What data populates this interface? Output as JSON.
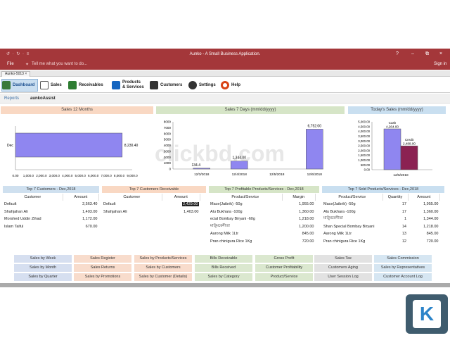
{
  "window": {
    "title": "Aunko - A Small Business Application.",
    "file_label": "File",
    "tell_me": "Tell me what you want to do...",
    "signin": "Sign in",
    "qat": "↺ · ↻ · ≡",
    "controls": [
      "?",
      "–",
      "⧉",
      "×"
    ]
  },
  "doc_tab": "Aunko-5013",
  "ribbon": {
    "items": [
      {
        "label": "Dashboard",
        "icon": "dashboard-icon",
        "color": "#3a7a3a"
      },
      {
        "label": "Sales",
        "icon": "bag-icon",
        "color": "#555"
      },
      {
        "label": "Receivables",
        "icon": "money-icon",
        "color": "#2e7d32"
      },
      {
        "label": "Products",
        "label2": "& Services",
        "icon": "box-icon",
        "color": "#1565c0"
      },
      {
        "label": "Customers",
        "icon": "people-icon",
        "color": "#333"
      },
      {
        "label": "Settings",
        "icon": "gear-icon",
        "color": "#333"
      },
      {
        "label": "Help",
        "icon": "lifebuoy-icon",
        "color": "#d84315"
      }
    ]
  },
  "reports_bar": {
    "reports": "Reports",
    "user": "aunkoAssist"
  },
  "panels": {
    "sales12": "Sales 12 Months",
    "sales7": "Sales 7 Days (mm/dd/yyyy)",
    "today": "Today's Sales (mm/dd/yyyy)"
  },
  "chart_data": [
    {
      "type": "bar",
      "orientation": "horizontal",
      "categories": [
        "Dec"
      ],
      "values": [
        8230.4
      ],
      "value_labels": [
        "8,230.40"
      ],
      "xticks": [
        "0.00",
        "1,000.0",
        "2,000.0",
        "3,000.0",
        "4,000.0",
        "5,000.0",
        "6,000.0",
        "7,000.0",
        "8,000.0",
        "9,000.0"
      ],
      "xlim": [
        0,
        9000
      ]
    },
    {
      "type": "bar",
      "categories": [
        "12/3/2018",
        "12/4/2018",
        "12/5/2018",
        "12/6/2018"
      ],
      "values": [
        134.4,
        1344.0,
        0,
        6752.0
      ],
      "value_labels": [
        "134.4",
        "1,344.00",
        "",
        "6,752.00"
      ],
      "yticks": [
        "0",
        "1000",
        "2000",
        "3000",
        "4000",
        "5000",
        "6000",
        "7000",
        "8000"
      ],
      "ylim": [
        0,
        8000
      ]
    },
    {
      "type": "bar",
      "categories": [
        "12/6/2018"
      ],
      "series": [
        {
          "name": "Cash",
          "values": [
            4264.0
          ],
          "color": "#8f86f0"
        },
        {
          "name": "Credit",
          "values": [
            2488.0
          ],
          "color": "#8b2252"
        }
      ],
      "value_labels": [
        "4,264.00",
        "2,488.00"
      ],
      "yticks": [
        "0.00",
        "500.00",
        "1,000.00",
        "1,500.00",
        "2,000.00",
        "2,500.00",
        "3,000.00",
        "3,500.00",
        "4,000.00",
        "4,500.00",
        "5,000.00"
      ],
      "ylim": [
        0,
        5000
      ]
    }
  ],
  "grids": {
    "customers": {
      "title": "Top 7 Customers - Dec,2018",
      "cols": [
        "Customer",
        "Amount"
      ],
      "rows": [
        [
          "Default",
          "2,563.40"
        ],
        [
          "Shahjahan Ali",
          "1,403.00"
        ],
        [
          "Morshed Uddin Zihad",
          "1,172.00"
        ],
        [
          "Islam Taiful",
          "670.00"
        ]
      ]
    },
    "receivable": {
      "title": "Top 7 Customers Receivable",
      "cols": [
        "Customer",
        "Amount"
      ],
      "rows": [
        [
          "Default",
          "2,429.00"
        ],
        [
          "Shahjahan Ali",
          "1,403.00"
        ]
      ]
    },
    "profitable": {
      "title": "Top 7 Profitable Products/Services - Dec,2018",
      "cols": [
        "Product/Service",
        "Margin"
      ],
      "rows": [
        [
          "Mace(Jaibrik) -50g",
          "1,955.00"
        ],
        [
          "Alu Bukhara -100g",
          "1,360.00"
        ],
        [
          "ecial Bombay Biryani -60g",
          "1,218.00"
        ],
        [
          "মাউুমরেনীতা",
          "1,200.00"
        ],
        [
          "Aarong Milk 1Ltr",
          "845.00"
        ],
        [
          "Pran chinigura Rice 1Kg",
          "720.00"
        ]
      ]
    },
    "sold": {
      "title": "Top 7 Sold Products/Services - Dec,2018",
      "cols": [
        "Product/Service",
        "Quantity",
        "Amount"
      ],
      "rows": [
        [
          "Mace(Jaibrik) -50g",
          "17",
          "1,955.00"
        ],
        [
          "Alu Bukhara -100g",
          "17",
          "1,360.00"
        ],
        [
          "মাউুমরেনীতা",
          "1",
          "1,344.00"
        ],
        [
          "Shan Special Bombay Biryani",
          "14",
          "1,218.00"
        ],
        [
          "Aarong Milk 1Ltr",
          "13",
          "845.00"
        ],
        [
          "Pran chinigura Rice 1Kg",
          "12",
          "720.00"
        ]
      ]
    }
  },
  "report_buttons": [
    [
      {
        "label": "Sales by Week",
        "color": "#d6dff0"
      },
      {
        "label": "Sales Register",
        "color": "#f8dccc"
      },
      {
        "label": "Sales by Products/Services",
        "color": "#f8dccc"
      },
      {
        "label": "Bills Receivable",
        "color": "#dbe8cf"
      },
      {
        "label": "Gross Profit",
        "color": "#dbe8cf"
      },
      {
        "label": "Sales Tax",
        "color": "#e2e2e2"
      },
      {
        "label": "Sales Commission",
        "color": "#d6e6f2"
      }
    ],
    [
      {
        "label": "Sales by Month",
        "color": "#d6dff0"
      },
      {
        "label": "Sales Returns",
        "color": "#f8dccc"
      },
      {
        "label": "Sales by Customers",
        "color": "#f8dccc"
      },
      {
        "label": "Bills Received",
        "color": "#dbe8cf"
      },
      {
        "label": "Customer Profitability",
        "color": "#dbe8cf"
      },
      {
        "label": "Customers Aging",
        "color": "#e2e2e2"
      },
      {
        "label": "Sales by Representatives",
        "color": "#d6e6f2"
      }
    ],
    [
      {
        "label": "Sales by Quarter",
        "color": "#d6dff0"
      },
      {
        "label": "Sales by Promotions",
        "color": "#f8dccc"
      },
      {
        "label": "Sales by Customer (Details)",
        "color": "#f8dccc"
      },
      {
        "label": "Sales by Category",
        "color": "#dbe8cf"
      },
      {
        "label": "Product/Service",
        "color": "#dbe8cf"
      },
      {
        "label": "User Session Log",
        "color": "#e2e2e2"
      },
      {
        "label": "Customer Account Log",
        "color": "#d6e6f2"
      }
    ]
  ],
  "watermark": "clickbd.com",
  "logo_letter": "K"
}
